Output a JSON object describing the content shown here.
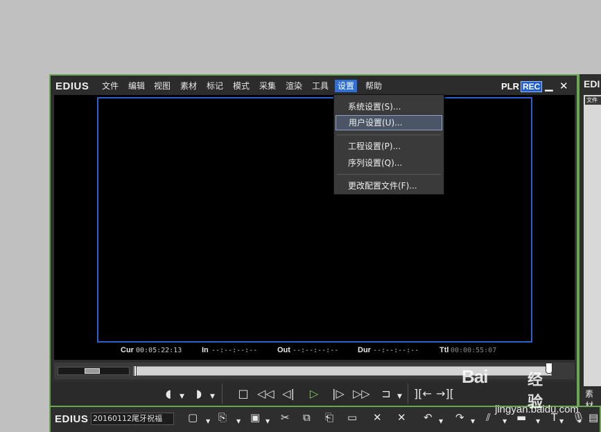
{
  "app": {
    "logo": "EDIUS"
  },
  "menubar": {
    "items": [
      {
        "label": "文件"
      },
      {
        "label": "编辑"
      },
      {
        "label": "视图"
      },
      {
        "label": "素材"
      },
      {
        "label": "标记"
      },
      {
        "label": "模式"
      },
      {
        "label": "采集"
      },
      {
        "label": "渲染"
      },
      {
        "label": "工具"
      },
      {
        "label": "设置",
        "active": true
      },
      {
        "label": "帮助"
      }
    ]
  },
  "titlebar_right": {
    "plr": "PLR",
    "rec": "REC",
    "minimize": "▁",
    "close": "✕"
  },
  "dropdown": {
    "items": [
      {
        "label": "系统设置(S)..."
      },
      {
        "label": "用户设置(U)...",
        "highlighted": true
      },
      {
        "label": "工程设置(P)..."
      },
      {
        "label": "序列设置(Q)..."
      },
      {
        "label": "更改配置文件(F)..."
      }
    ]
  },
  "timecodes": {
    "cur_label": "Cur",
    "cur": "00:05:22:13",
    "in_label": "In",
    "in": "--:--:--:--",
    "out_label": "Out",
    "out": "--:--:--:--",
    "dur_label": "Dur",
    "dur": "--:--:--:--",
    "ttl_label": "Ttl",
    "ttl": "00:00:55:07"
  },
  "right_window": {
    "title": "EDI",
    "tab": "文件",
    "bottom_label": "素材"
  },
  "timeline_window": {
    "logo": "EDIUS",
    "project_name": "20160112尾牙祝福"
  },
  "watermark": {
    "brand": "Bai",
    "brand_cn": "经验",
    "url": "jingyan.baidu.com"
  },
  "colors": {
    "accent": "#2e6fd8",
    "frame": "#2c5fd6",
    "window_border": "#6aa84f",
    "play": "#7ec850"
  },
  "icons": {
    "transport": [
      "mark-in-icon",
      "mark-out-icon",
      "stop-icon",
      "rewind-icon",
      "step-back-icon",
      "play-icon",
      "step-forward-icon",
      "fast-forward-icon",
      "loop-icon",
      "insert-icon",
      "overwrite-icon"
    ],
    "timeline_toolbar": [
      "new-icon",
      "open-icon",
      "save-icon",
      "cut-icon",
      "copy-icon",
      "paste-icon",
      "clip-icon",
      "delete-icon",
      "ripple-delete-icon",
      "undo-icon",
      "redo-icon",
      "split-icon",
      "group-icon",
      "text-icon",
      "mic-icon",
      "monitor-icon"
    ]
  }
}
